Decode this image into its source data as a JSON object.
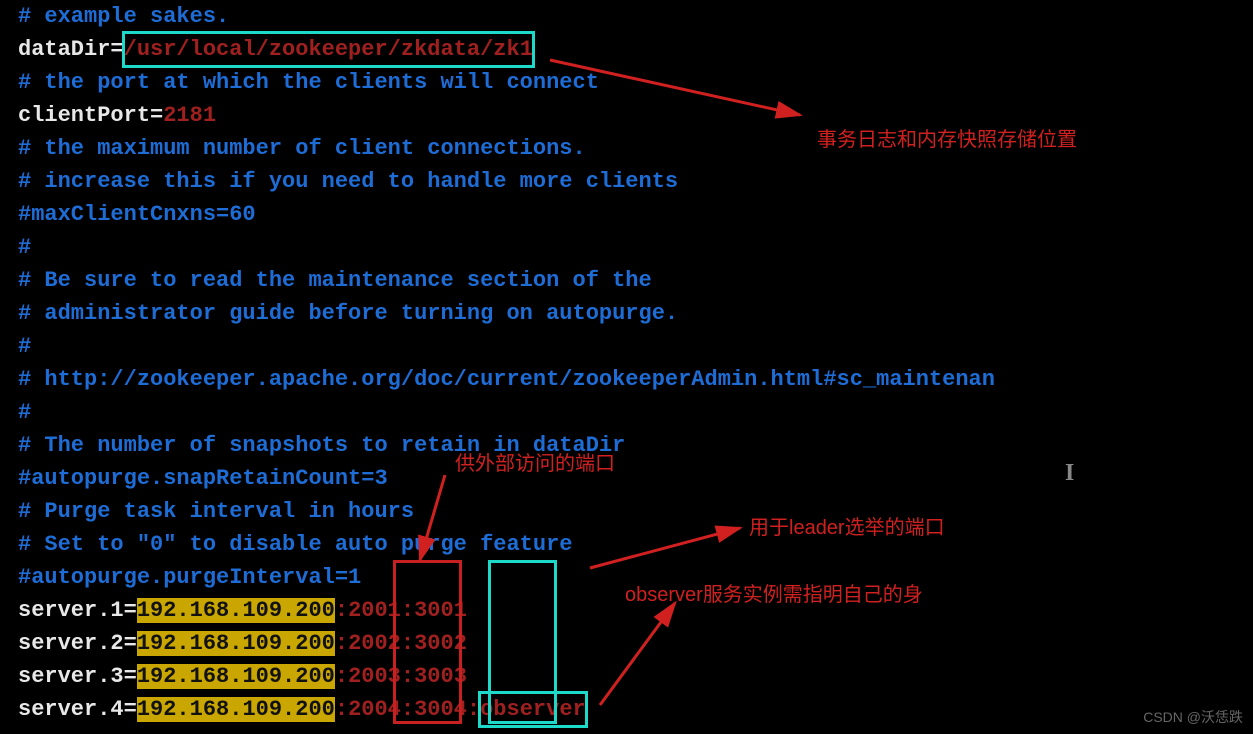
{
  "lines": {
    "l1": "# example sakes.",
    "l2_key": "dataDir=",
    "l2_val": "/usr/local/zookeeper/zkdata/zk1",
    "l3": "# the port at which the clients will connect",
    "l4_key": "clientPort=",
    "l4_val": "2181",
    "l5": "# the maximum number of client connections.",
    "l6": "# increase this if you need to handle more clients",
    "l7": "#maxClientCnxns=60",
    "l8": "#",
    "l9": "# Be sure to read the maintenance section of the",
    "l10": "# administrator guide before turning on autopurge.",
    "l11": "#",
    "l12": "# http://zookeeper.apache.org/doc/current/zookeeperAdmin.html#sc_maintenan",
    "l13": "#",
    "l14": "# The number of snapshots to retain in dataDir",
    "l15": "#autopurge.snapRetainCount=3",
    "l16": "# Purge task interval in hours",
    "l17": "# Set to \"0\" to disable auto purge feature",
    "l18": "#autopurge.purgeInterval=1",
    "sv1_key": "server.1=",
    "sv1_ip": "192.168.109.200",
    "sv1_p1": "2001",
    "sv1_p2": "3001",
    "colon": ":",
    "sv2_key": "server.2=",
    "sv2_ip": "192.168.109.200",
    "sv2_p1": "2002",
    "sv2_p2": "3002",
    "sv3_key": "server.3=",
    "sv3_ip": "192.168.109.200",
    "sv3_p1": "2003",
    "sv3_p2": "3003",
    "sv4_key": "server.4=",
    "sv4_ip": "192.168.109.200",
    "sv4_p1": "2004",
    "sv4_p2": "3004",
    "sv4_role": "observer"
  },
  "annotations": {
    "a1": "事务日志和内存快照存储位置",
    "a2": "供外部访问的端口",
    "a3": "用于leader选举的端口",
    "a4": "observer服务实例需指明自己的身"
  },
  "watermark": "CSDN @沃恁跌"
}
